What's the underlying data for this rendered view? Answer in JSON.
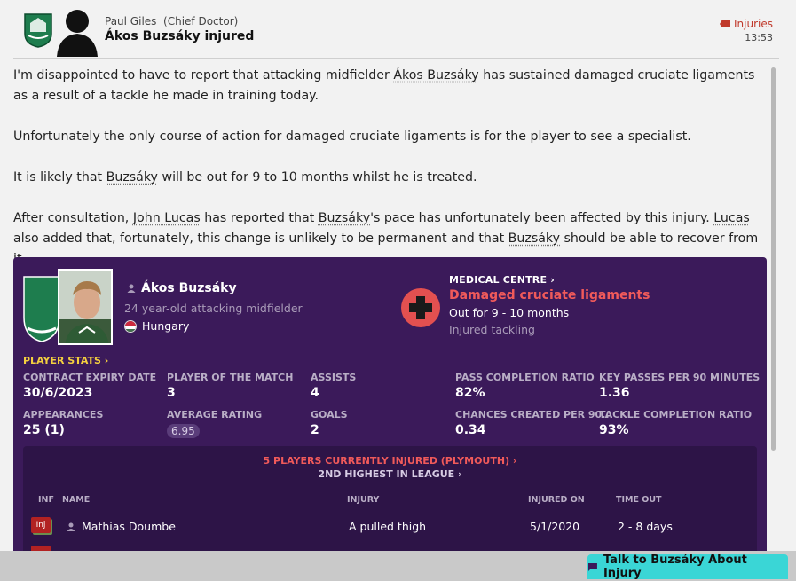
{
  "header": {
    "sender_name": "Paul Giles",
    "sender_role": "(Chief Doctor)",
    "subject": "Ákos Buzsáky injured",
    "category": "Injuries",
    "time": "13:53"
  },
  "message": {
    "p1_a": "I'm disappointed to have to report that attacking midfielder ",
    "p1_player": "Ákos Buzsáky",
    "p1_b": " has sustained damaged cruciate ligaments as a result of a tackle he made in training today.",
    "p2": "Unfortunately the only course of action for damaged cruciate ligaments is for the player to see a specialist.",
    "p3_a": "It is likely that ",
    "p3_player": "Buzsáky",
    "p3_b": " will be out for 9 to 10 months whilst he is treated.",
    "p4_a": "After consultation, ",
    "p4_staff": "John Lucas",
    "p4_b": " has reported that ",
    "p4_player": "Buzsáky",
    "p4_c": "'s pace has unfortunately been affected by this injury. ",
    "p4_staff2": "Lucas",
    "p4_d": " also added that, fortunately, this change is unlikely to be permanent and that ",
    "p4_player2": "Buzsáky",
    "p4_e": " should be able to recover from it."
  },
  "player": {
    "name": "Ákos Buzsáky",
    "description": "24 year-old attacking midfielder",
    "nation": "Hungary"
  },
  "medical": {
    "title": "MEDICAL CENTRE",
    "injury": "Damaged cruciate ligaments",
    "out_for": "Out for 9 - 10 months",
    "reason": "Injured tackling"
  },
  "stats": {
    "title": "PLAYER STATS",
    "items": [
      {
        "label": "CONTRACT EXPIRY DATE",
        "value": "30/6/2023"
      },
      {
        "label": "PLAYER OF THE MATCH",
        "value": "3"
      },
      {
        "label": "ASSISTS",
        "value": "4"
      },
      {
        "label": "PASS COMPLETION RATIO",
        "value": "82%"
      },
      {
        "label": "KEY PASSES PER 90 MINUTES",
        "value": "1.36"
      },
      {
        "label": "APPEARANCES",
        "value": "25 (1)"
      },
      {
        "label": "AVERAGE RATING",
        "value": "6.95"
      },
      {
        "label": "GOALS",
        "value": "2"
      },
      {
        "label": "CHANCES CREATED PER 90...",
        "value": "0.34"
      },
      {
        "label": "TACKLE COMPLETION RATIO",
        "value": "93%"
      }
    ]
  },
  "injury_panel": {
    "count_text": "5 PLAYERS CURRENTLY INJURED (PLYMOUTH)",
    "rank_text": "2ND HIGHEST IN LEAGUE",
    "columns": [
      "INF",
      "NAME",
      "INJURY",
      "INJURED ON",
      "TIME OUT"
    ],
    "rows": [
      {
        "inf": "Inj",
        "name": "Mathias Doumbe",
        "injury": "A pulled thigh",
        "injured_on": "5/1/2020",
        "time_out": "2 - 8 days"
      }
    ]
  },
  "footer": {
    "talk_button": "Talk to Buzsáky About Injury"
  },
  "colors": {
    "card_bg": "#3b1a5a",
    "injury_red": "#f05a5a",
    "stats_yellow": "#f4d03f",
    "button_cyan": "#3ad6d6"
  }
}
